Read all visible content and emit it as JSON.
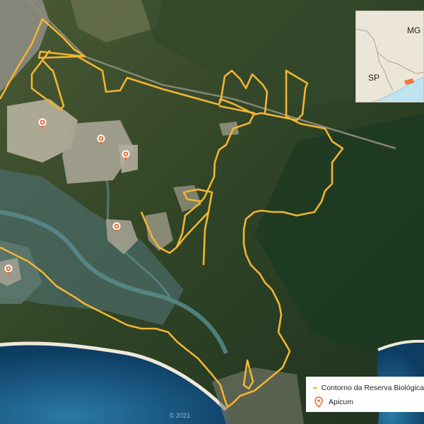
{
  "map": {
    "copyright": "© 2021"
  },
  "inset": {
    "labels": {
      "mg": "MG",
      "sp": "SP"
    },
    "colors": {
      "land": "#ece6d9",
      "sea": "#bfe3ef",
      "border": "#9a9488"
    }
  },
  "legend": {
    "boundary_label": "Contorno da Reserva Biológica",
    "apicum_label": "Apicum",
    "boundary_color": "#f2b531",
    "apicum_color": "#ef6a2e"
  },
  "markers": [
    {
      "type": "apicum",
      "icon": "map-pin-icon"
    },
    {
      "type": "apicum",
      "icon": "map-pin-icon"
    },
    {
      "type": "apicum",
      "icon": "map-pin-icon"
    },
    {
      "type": "apicum",
      "icon": "map-pin-icon"
    },
    {
      "type": "apicum",
      "icon": "map-pin-icon"
    }
  ]
}
